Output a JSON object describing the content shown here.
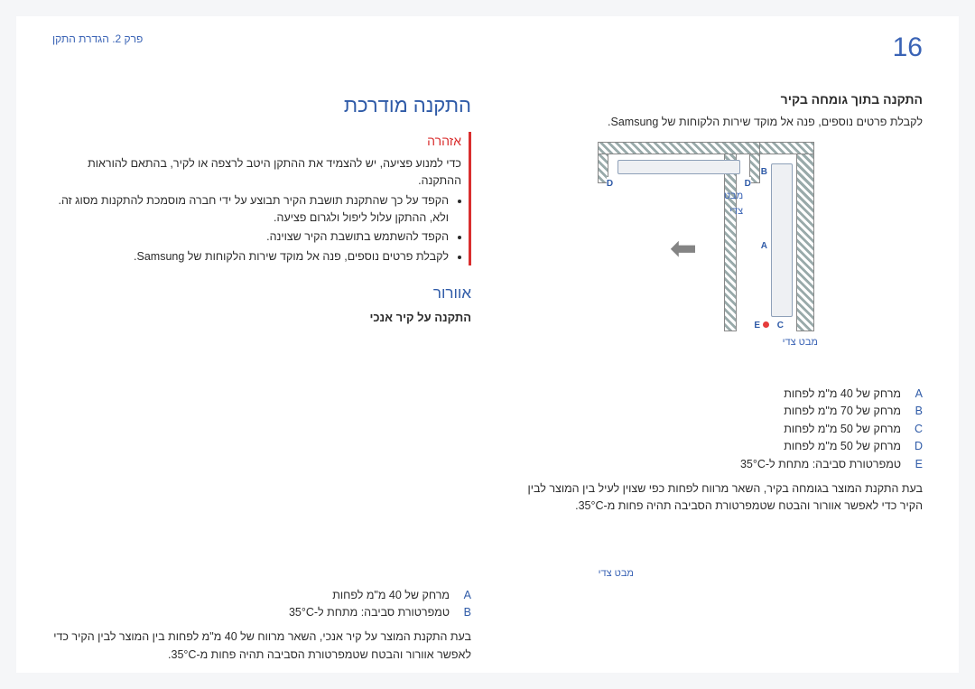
{
  "page_number": "16",
  "breadcrumb": "פרק 2. הגדרת התקן",
  "right": {
    "title": "התקנה מודרכת",
    "warning_title": "אזהרה",
    "warning_intro": "כדי למנוע פציעה, יש להצמיד את ההתקן היטב לרצפה או לקיר, בהתאם להוראות ההתקנה.",
    "warning_bullets": [
      "הקפד על כך שהתקנת תושבת הקיר תבוצע על ידי חברה מוסמכת להתקנות מסוג זה. ולא, ההתקן עלול ליפול ולגרום פציעה.",
      "הקפד להשתמש בתושבת הקיר שצוינה.",
      "לקבלת פרטים נוספים, פנה אל מוקד שירות הלקוחות של Samsung."
    ],
    "vent_title": "אוורור",
    "vent_sub": "התקנה על קיר אנכי",
    "caption_side": "מבט צדי",
    "legend": [
      {
        "key": "A",
        "text": "מרחק של 40 מ\"מ לפחות"
      },
      {
        "key": "B",
        "text": "טמפרטורת סביבה: מתחת ל-35°C"
      }
    ],
    "body": "בעת התקנת המוצר על קיר אנכי, השאר מרווח של 40 מ\"מ לפחות בין המוצר לבין הקיר כדי לאפשר אוורור והבטח שטמפרטורת הסביבה תהיה פחות מ-35°C."
  },
  "left": {
    "title": "התקנה בתוך גומחה בקיר",
    "sub": "לקבלת פרטים נוספים, פנה אל מוקד שירות הלקוחות של Samsung.",
    "caption_side_1": "מבט צדי",
    "caption_side_2": "מבט צדי",
    "legend": [
      {
        "key": "A",
        "text": "מרחק של 40 מ\"מ לפחות"
      },
      {
        "key": "B",
        "text": "מרחק של 70 מ\"מ לפחות"
      },
      {
        "key": "C",
        "text": "מרחק של 50 מ\"מ לפחות"
      },
      {
        "key": "D",
        "text": "מרחק של 50 מ\"מ לפחות"
      },
      {
        "key": "E",
        "text": "טמפרטורת סביבה: מתחת ל-35°C"
      }
    ],
    "body": "בעת התקנת המוצר בגומחה בקיר, השאר מרווח לפחות כפי שצוין לעיל בין המוצר לבין הקיר כדי לאפשר אוורור והבטח שטמפרטורת הסביבה תהיה פחות מ-35°C."
  },
  "markers": {
    "A": "A",
    "B": "B",
    "C": "C",
    "D": "D",
    "E": "E"
  }
}
